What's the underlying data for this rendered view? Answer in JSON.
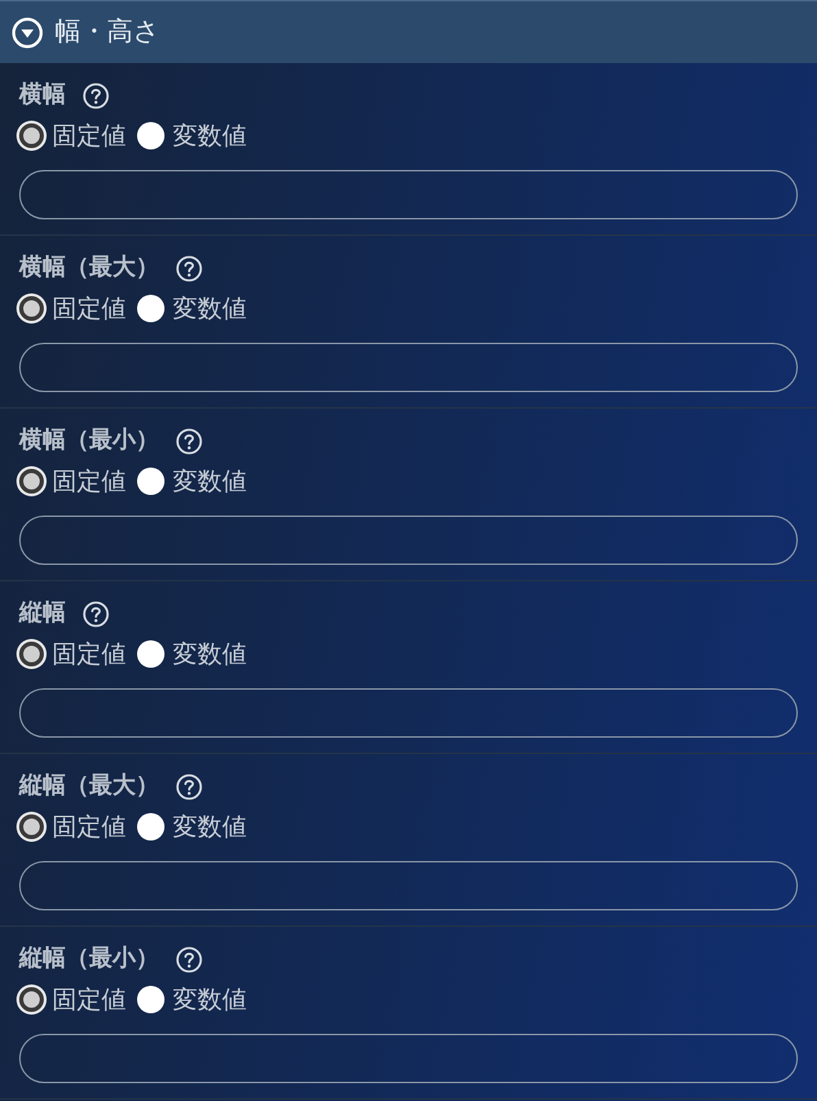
{
  "section": {
    "title": "幅・高さ",
    "expanded": true
  },
  "fields": [
    {
      "label": "横幅",
      "options": [
        {
          "label": "固定値",
          "selected": true
        },
        {
          "label": "変数値",
          "selected": false
        }
      ]
    },
    {
      "label": "横幅（最大）",
      "options": [
        {
          "label": "固定値",
          "selected": true
        },
        {
          "label": "変数値",
          "selected": false
        }
      ]
    },
    {
      "label": "横幅（最小）",
      "options": [
        {
          "label": "固定値",
          "selected": true
        },
        {
          "label": "変数値",
          "selected": false
        }
      ]
    },
    {
      "label": "縦幅",
      "options": [
        {
          "label": "固定値",
          "selected": true
        },
        {
          "label": "変数値",
          "selected": false
        }
      ]
    },
    {
      "label": "縦幅（最大）",
      "options": [
        {
          "label": "固定値",
          "selected": true
        },
        {
          "label": "変数値",
          "selected": false
        }
      ]
    },
    {
      "label": "縦幅（最小）",
      "options": [
        {
          "label": "固定値",
          "selected": true
        },
        {
          "label": "変数値",
          "selected": false
        }
      ]
    }
  ]
}
